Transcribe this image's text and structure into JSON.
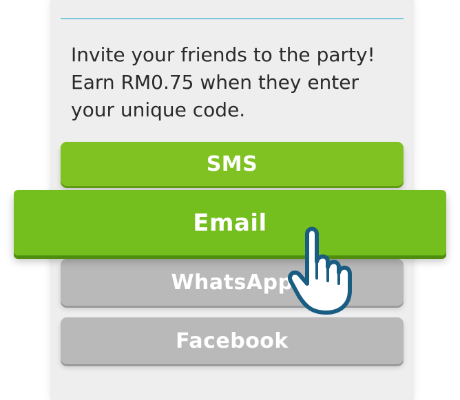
{
  "invite": {
    "message": "Invite your friends to the party!\nEarn RM0.75 when they enter\nyour unique code."
  },
  "share_options": {
    "sms_label": "SMS",
    "email_label": "Email",
    "whatsapp_label": "WhatsApp",
    "facebook_label": "Facebook"
  },
  "colors": {
    "active_green": "#74be1e",
    "inactive_gray": "#b9b9b9",
    "divider_blue": "#7fc6d8",
    "hand_outline": "#1a5d82"
  },
  "icons": {
    "pointer": "hand-pointer-icon"
  }
}
